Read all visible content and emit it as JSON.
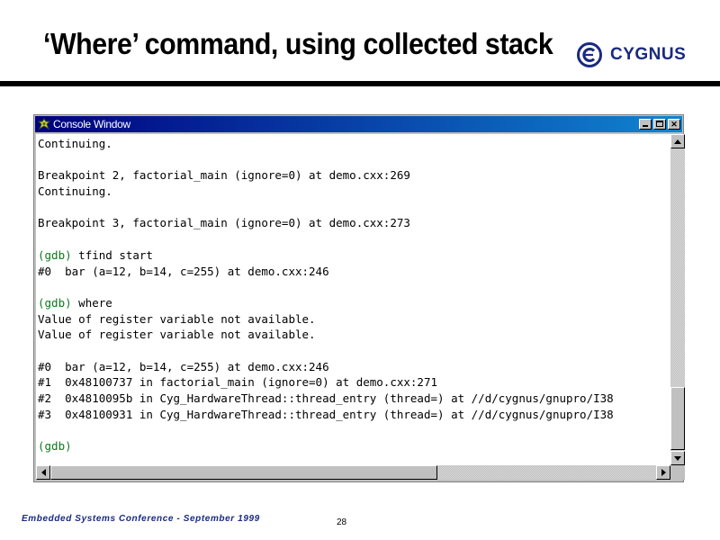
{
  "slide": {
    "title": "‘Where’ command, using collected stack",
    "logo_text": "CYGNUS",
    "footer": "Embedded Systems Conference - September 1999",
    "page_number": "28"
  },
  "window": {
    "title": "Console Window",
    "controls": {
      "minimize": "minimize",
      "maximize": "maximize",
      "close": "✕"
    }
  },
  "console": {
    "lines": [
      {
        "prompt": "",
        "text": "Continuing."
      },
      {
        "prompt": "",
        "text": ""
      },
      {
        "prompt": "",
        "text": "Breakpoint 2, factorial_main (ignore=0) at demo.cxx:269"
      },
      {
        "prompt": "",
        "text": "Continuing."
      },
      {
        "prompt": "",
        "text": ""
      },
      {
        "prompt": "",
        "text": "Breakpoint 3, factorial_main (ignore=0) at demo.cxx:273"
      },
      {
        "prompt": "",
        "text": ""
      },
      {
        "prompt": "(gdb)",
        "text": " tfind start"
      },
      {
        "prompt": "",
        "text": "#0  bar (a=12, b=14, c=255) at demo.cxx:246"
      },
      {
        "prompt": "",
        "text": ""
      },
      {
        "prompt": "(gdb)",
        "text": " where"
      },
      {
        "prompt": "",
        "text": "Value of register variable not available."
      },
      {
        "prompt": "",
        "text": "Value of register variable not available."
      },
      {
        "prompt": "",
        "text": ""
      },
      {
        "prompt": "",
        "text": "#0  bar (a=12, b=14, c=255) at demo.cxx:246"
      },
      {
        "prompt": "",
        "text": "#1  0x48100737 in factorial_main (ignore=0) at demo.cxx:271"
      },
      {
        "prompt": "",
        "text": "#2  0x4810095b in Cyg_HardwareThread::thread_entry (thread=) at //d/cygnus/gnupro/I38"
      },
      {
        "prompt": "",
        "text": "#3  0x48100931 in Cyg_HardwareThread::thread_entry (thread=) at //d/cygnus/gnupro/I38"
      },
      {
        "prompt": "",
        "text": ""
      },
      {
        "prompt": "(gdb)",
        "text": ""
      }
    ]
  },
  "colors": {
    "titlebar": "#000080",
    "prompt": "#0a7a1a",
    "logo": "#1a2a80"
  }
}
